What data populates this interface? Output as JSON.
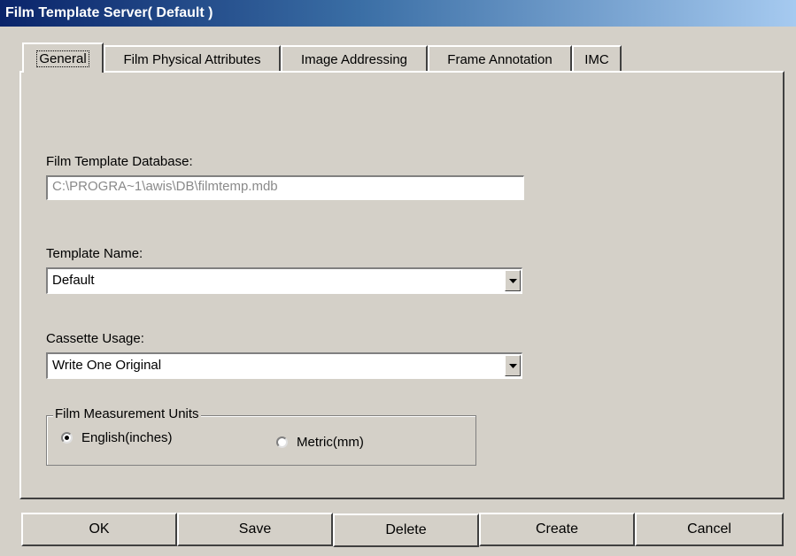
{
  "window": {
    "title": "Film Template Server( Default )"
  },
  "tabs": [
    {
      "label": "General",
      "active": true
    },
    {
      "label": "Film Physical Attributes",
      "active": false
    },
    {
      "label": "Image Addressing",
      "active": false
    },
    {
      "label": "Frame Annotation",
      "active": false
    },
    {
      "label": "IMC",
      "active": false
    }
  ],
  "general": {
    "database_label": "Film Template Database:",
    "database_value": "C:\\PROGRA~1\\awis\\DB\\filmtemp.mdb",
    "template_label": "Template Name:",
    "template_value": "Default",
    "cassette_label": "Cassette Usage:",
    "cassette_value": "Write One Original",
    "units_group_label": "Film Measurement Units",
    "units_options": [
      {
        "label": "English(inches)",
        "selected": true
      },
      {
        "label": "Metric(mm)",
        "selected": false
      }
    ]
  },
  "buttons": {
    "ok": "OK",
    "save": "Save",
    "delete": "Delete",
    "create": "Create",
    "cancel": "Cancel"
  },
  "icons": {
    "dropdown_arrow": "chevron-down-icon"
  }
}
